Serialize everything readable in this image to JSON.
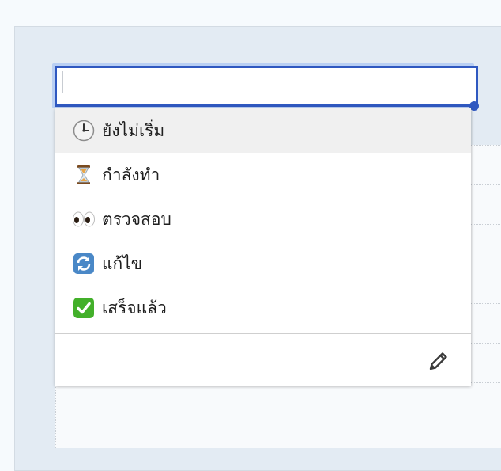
{
  "search": {
    "value": "",
    "placeholder": ""
  },
  "status_options": [
    {
      "icon": "clock-icon",
      "label": "ยังไม่เริ่ม",
      "highlighted": true
    },
    {
      "icon": "hourglass-icon",
      "label": "กำลังทำ",
      "highlighted": false
    },
    {
      "icon": "eyes-icon",
      "label": "ตรวจสอบ",
      "highlighted": false
    },
    {
      "icon": "refresh-icon",
      "label": "แก้ไข",
      "highlighted": false
    },
    {
      "icon": "check-icon",
      "label": "เสร็จแล้ว",
      "highlighted": false
    }
  ],
  "footer": {
    "edit_icon": "pencil-icon"
  },
  "colors": {
    "focus_border": "#2f58c0",
    "focus_glow": "#b9cff3",
    "highlight_row": "#f0f0f0",
    "check_green": "#43b02a",
    "refresh_blue": "#4a88c7"
  }
}
